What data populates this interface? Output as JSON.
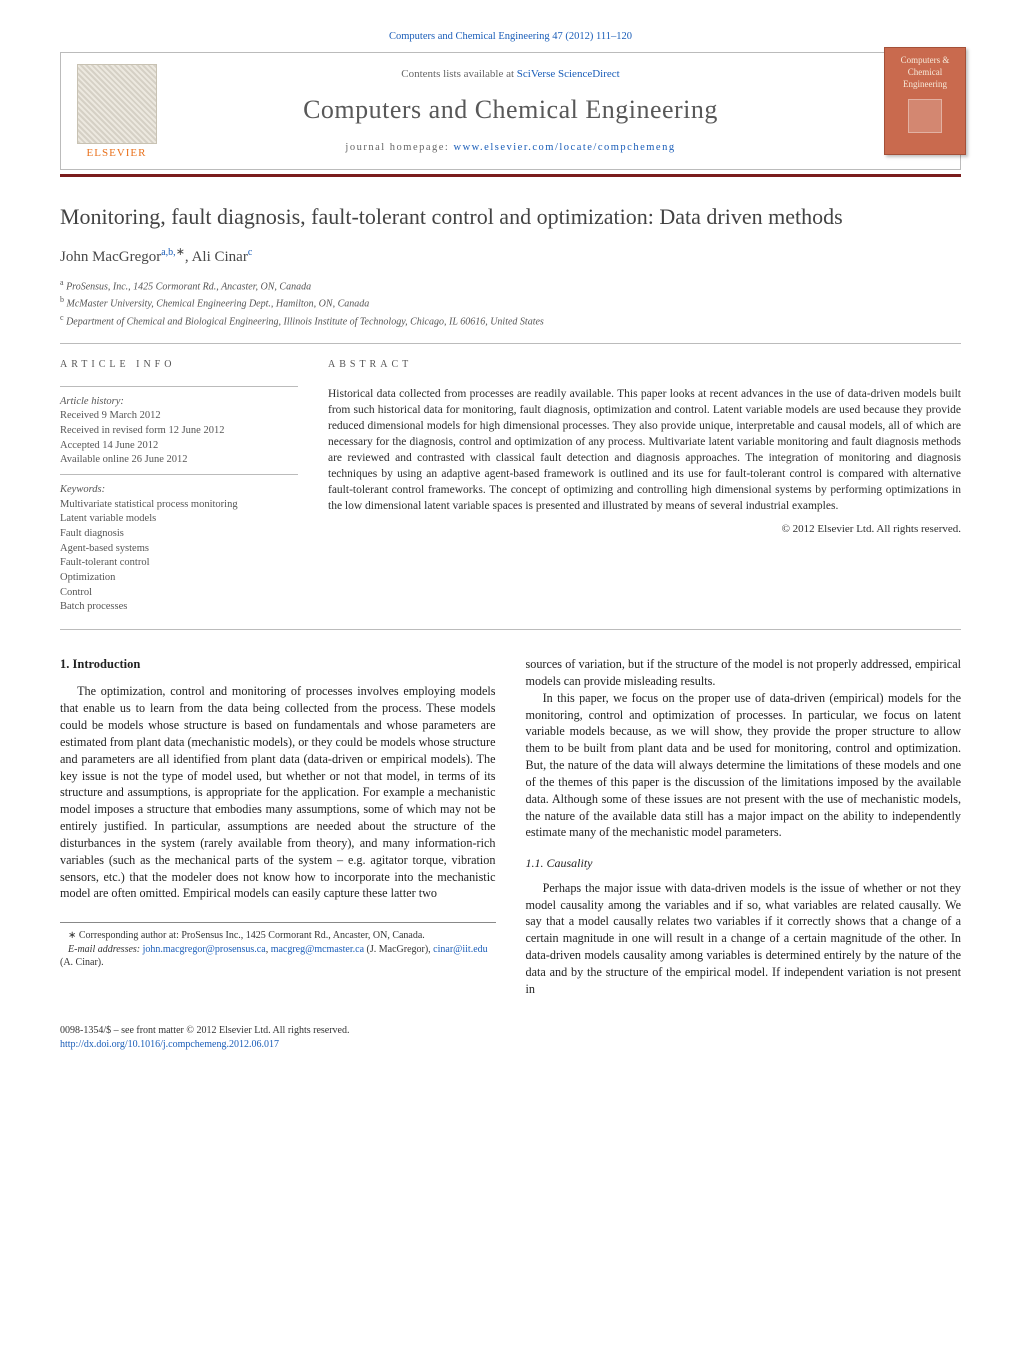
{
  "citation": {
    "journal_link": "Computers and Chemical Engineering 47 (2012) 111–120"
  },
  "header": {
    "contents_text": "Contents lists available at",
    "contents_link": "SciVerse ScienceDirect",
    "journal_name": "Computers and Chemical Engineering",
    "homepage_label": "journal homepage:",
    "homepage_link": "www.elsevier.com/locate/compchemeng",
    "publisher": "ELSEVIER",
    "cover_text": "Computers & Chemical Engineering"
  },
  "title": "Monitoring, fault diagnosis, fault-tolerant control and optimization: Data driven methods",
  "authors_html": "John MacGregor",
  "author1_sup": "a,b,",
  "author_star": "∗",
  "authors_sep": ", ",
  "author2": "Ali Cinar",
  "author2_sup": "c",
  "affiliations": [
    {
      "sup": "a",
      "text": "ProSensus, Inc., 1425 Cormorant Rd., Ancaster, ON, Canada"
    },
    {
      "sup": "b",
      "text": "McMaster University, Chemical Engineering Dept., Hamilton, ON, Canada"
    },
    {
      "sup": "c",
      "text": "Department of Chemical and Biological Engineering, Illinois Institute of Technology, Chicago, IL 60616, United States"
    }
  ],
  "article_info_head": "ARTICLE INFO",
  "history_head": "Article history:",
  "history": [
    "Received 9 March 2012",
    "Received in revised form 12 June 2012",
    "Accepted 14 June 2012",
    "Available online 26 June 2012"
  ],
  "keywords_head": "Keywords:",
  "keywords": [
    "Multivariate statistical process monitoring",
    "Latent variable models",
    "Fault diagnosis",
    "Agent-based systems",
    "Fault-tolerant control",
    "Optimization",
    "Control",
    "Batch processes"
  ],
  "abstract_head": "ABSTRACT",
  "abstract": "Historical data collected from processes are readily available. This paper looks at recent advances in the use of data-driven models built from such historical data for monitoring, fault diagnosis, optimization and control. Latent variable models are used because they provide reduced dimensional models for high dimensional processes. They also provide unique, interpretable and causal models, all of which are necessary for the diagnosis, control and optimization of any process. Multivariate latent variable monitoring and fault diagnosis methods are reviewed and contrasted with classical fault detection and diagnosis approaches. The integration of monitoring and diagnosis techniques by using an adaptive agent-based framework is outlined and its use for fault-tolerant control is compared with alternative fault-tolerant control frameworks. The concept of optimizing and controlling high dimensional systems by performing optimizations in the low dimensional latent variable spaces is presented and illustrated by means of several industrial examples.",
  "copyright": "© 2012 Elsevier Ltd. All rights reserved.",
  "sections": {
    "s1_head": "1.  Introduction",
    "s1_p1": "The optimization, control and monitoring of processes involves employing models that enable us to learn from the data being collected from the process. These models could be models whose structure is based on fundamentals and whose parameters are estimated from plant data (mechanistic models), or they could be models whose structure and parameters are all identified from plant data (data-driven or empirical models). The key issue is not the type of model used, but whether or not that model, in terms of its structure and assumptions, is appropriate for the application. For example a mechanistic model imposes a structure that embodies many assumptions, some of which may not be entirely justified. In particular, assumptions are needed about the structure of the disturbances in the system (rarely available from theory), and many information-rich variables (such as the mechanical parts of the system – e.g. agitator torque, vibration sensors, etc.) that the modeler does not know how to incorporate into the mechanistic model are often omitted. Empirical models can easily capture these latter two",
    "s1_p2": "sources of variation, but if the structure of the model is not properly addressed, empirical models can provide misleading results.",
    "s1_p3": "In this paper, we focus on the proper use of data-driven (empirical) models for the monitoring, control and optimization of processes. In particular, we focus on latent variable models because, as we will show, they provide the proper structure to allow them to be built from plant data and be used for monitoring, control and optimization. But, the nature of the data will always determine the limitations of these models and one of the themes of this paper is the discussion of the limitations imposed by the available data. Although some of these issues are not present with the use of mechanistic models, the nature of the available data still has a major impact on the ability to independently estimate many of the mechanistic model parameters.",
    "s11_head": "1.1.  Causality",
    "s11_p1": "Perhaps the major issue with data-driven models is the issue of whether or not they model causality among the variables and if so, what variables are related causally. We say that a model causally relates two variables if it correctly shows that a change of a certain magnitude in one will result in a change of a certain magnitude of the other. In data-driven models causality among variables is determined entirely by the nature of the data and by the structure of the empirical model. If independent variation is not present in"
  },
  "footnote": {
    "corr_label": "∗ Corresponding author at: ProSensus Inc., 1425 Cormorant Rd., Ancaster, ON, Canada.",
    "email_label": "E-mail addresses:",
    "email1": "john.macgregor@prosensus.ca",
    "email1_sep": ", ",
    "email2": "macgreg@mcmaster.ca",
    "email_p1_tail": "(J. MacGregor),",
    "email3": "cinar@iit.edu",
    "email_p2_tail": "(A. Cinar)."
  },
  "bottom": {
    "issn": "0098-1354/$ – see front matter © 2012 Elsevier Ltd. All rights reserved.",
    "doi": "http://dx.doi.org/10.1016/j.compchemeng.2012.06.017"
  }
}
